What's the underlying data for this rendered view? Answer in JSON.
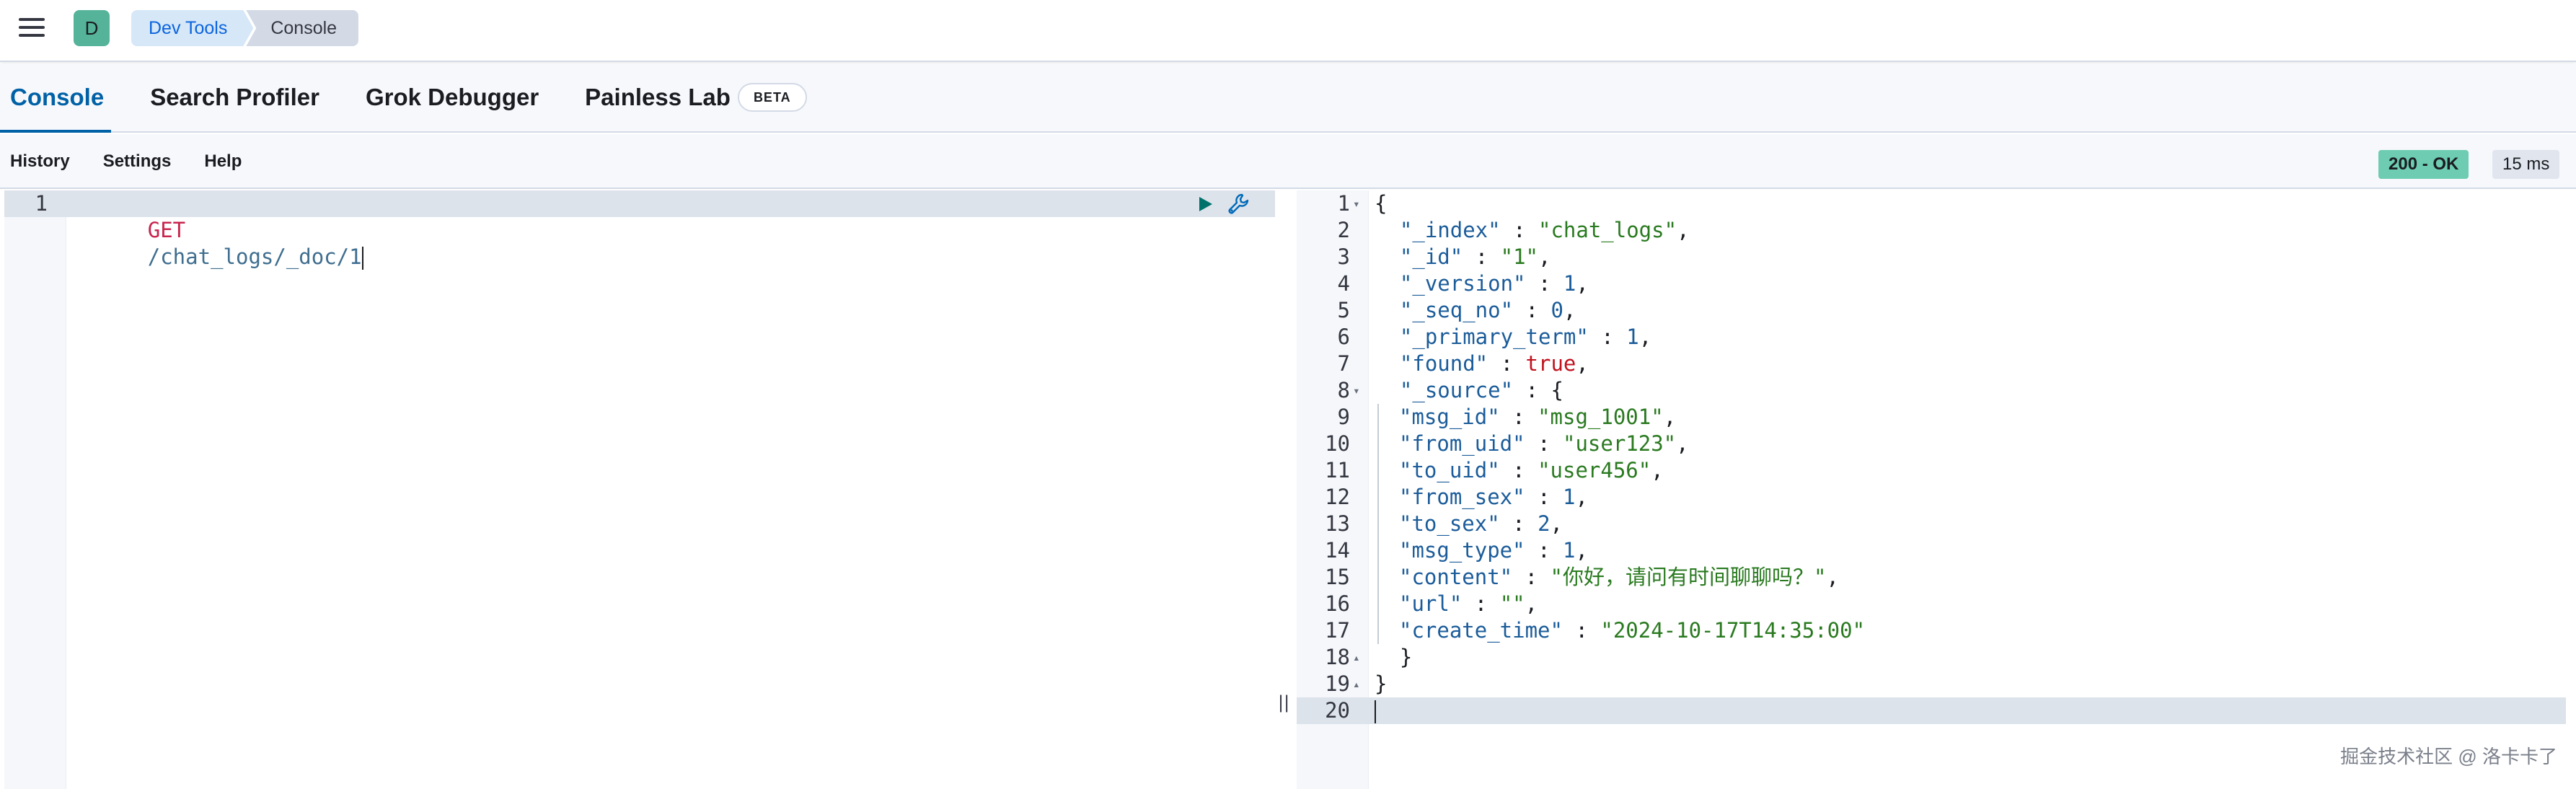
{
  "header": {
    "avatar_letter": "D",
    "breadcrumbs": [
      "Dev Tools",
      "Console"
    ]
  },
  "tabs": [
    {
      "label": "Console",
      "active": true
    },
    {
      "label": "Search Profiler"
    },
    {
      "label": "Grok Debugger"
    },
    {
      "label": "Painless Lab",
      "badge": "BETA"
    }
  ],
  "toolbar": {
    "menu": [
      "History",
      "Settings",
      "Help"
    ],
    "status": "200 - OK",
    "timing": "15 ms"
  },
  "request": {
    "line_number": "1",
    "method": "GET",
    "path": "/chat_logs/_doc/1"
  },
  "response": {
    "line_numbers": [
      "1",
      "2",
      "3",
      "4",
      "5",
      "6",
      "7",
      "8",
      "9",
      "10",
      "11",
      "12",
      "13",
      "14",
      "15",
      "16",
      "17",
      "18",
      "19",
      "20"
    ],
    "index_key": "\"_index\"",
    "index_val": "\"chat_logs\"",
    "id_key": "\"_id\"",
    "id_val": "\"1\"",
    "version_key": "\"_version\"",
    "version_val": "1",
    "seq_key": "\"_seq_no\"",
    "seq_val": "0",
    "term_key": "\"_primary_term\"",
    "term_val": "1",
    "found_key": "\"found\"",
    "found_val": "true",
    "source_key": "\"_source\"",
    "msg_id_key": "\"msg_id\"",
    "msg_id_val": "\"msg_1001\"",
    "from_uid_key": "\"from_uid\"",
    "from_uid_val": "\"user123\"",
    "to_uid_key": "\"to_uid\"",
    "to_uid_val": "\"user456\"",
    "from_sex_key": "\"from_sex\"",
    "from_sex_val": "1",
    "to_sex_key": "\"to_sex\"",
    "to_sex_val": "2",
    "msg_type_key": "\"msg_type\"",
    "msg_type_val": "1",
    "content_key": "\"content\"",
    "content_val": "\"你好，请问有时间聊聊吗？\"",
    "url_key": "\"url\"",
    "url_val": "\"\"",
    "create_time_key": "\"create_time\"",
    "create_time_val": "\"2024-10-17T14:35:00\""
  },
  "splitter_glyph": "||",
  "watermark": "掘金技术社区 @ 洛卡卡了",
  "colors": {
    "accent": "#0061a6",
    "status_ok": "#6dccb1",
    "avatar": "#54b399"
  }
}
